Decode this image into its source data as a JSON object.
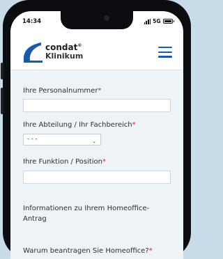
{
  "status_bar": {
    "time": "14:34",
    "network": "5G"
  },
  "header": {
    "brand": "condat",
    "brand_mark": "®",
    "subtitle": "Klinikum",
    "menu_icon": "hamburger-menu-icon",
    "accent_color": "#1d5aa5"
  },
  "form": {
    "personalnummer_label": "Ihre Personalnummer",
    "abteilung_label": "Ihre Abteilung / Ihr Fachbereich",
    "abteilung_selected": "- - -",
    "funktion_label": "Ihre Funktion / Position",
    "info_heading": "Informationen zu Ihrem Homeoffice-Antrag",
    "warum_label": "Warum beantragen Sie Homeoffice?",
    "required_marker": "*",
    "required_color": "#d32530"
  }
}
